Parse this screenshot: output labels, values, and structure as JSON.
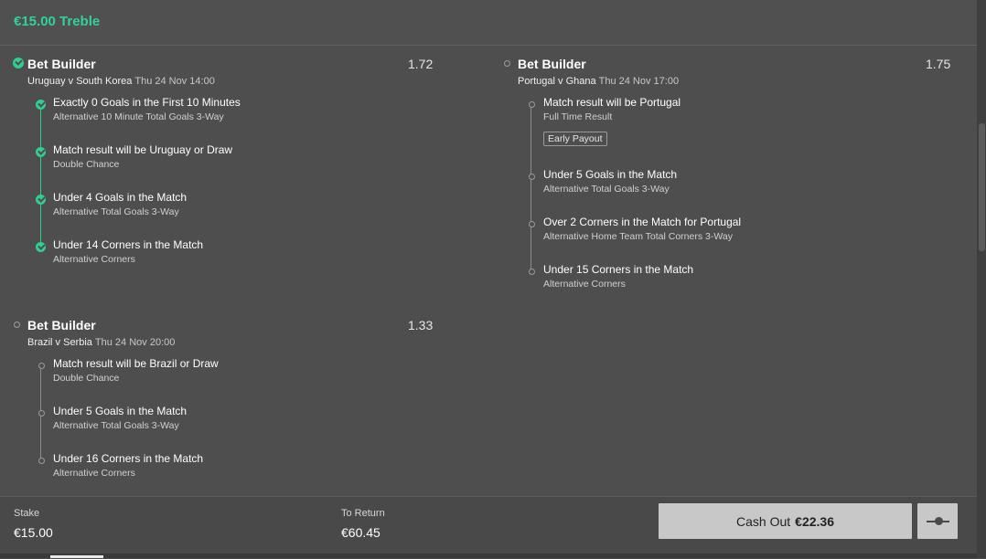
{
  "header": {
    "title": "€15.00 Treble"
  },
  "bet_builders": [
    {
      "title": "Bet Builder",
      "odds": "1.72",
      "match": "Uruguay v South Korea",
      "date": "Thu 24 Nov 14:00",
      "status": "settled",
      "legs": [
        {
          "name": "Exactly 0 Goals in the First 10 Minutes",
          "market": "Alternative 10 Minute Total Goals 3-Way"
        },
        {
          "name": "Match result will be Uruguay or Draw",
          "market": "Double Chance"
        },
        {
          "name": "Under 4 Goals in the Match",
          "market": "Alternative Total Goals 3-Way"
        },
        {
          "name": "Under 14 Corners in the Match",
          "market": "Alternative Corners"
        }
      ]
    },
    {
      "title": "Bet Builder",
      "odds": "1.75",
      "match": "Portugal v Ghana",
      "date": "Thu 24 Nov 17:00",
      "status": "open",
      "early_payout": "Early Payout",
      "legs": [
        {
          "name": "Match result will be Portugal",
          "market": "Full Time Result"
        },
        {
          "name": "Under 5 Goals in the Match",
          "market": "Alternative Total Goals 3-Way"
        },
        {
          "name": "Over 2 Corners in the Match for Portugal",
          "market": "Alternative Home Team Total Corners 3-Way"
        },
        {
          "name": "Under 15 Corners in the Match",
          "market": "Alternative Corners"
        }
      ]
    },
    {
      "title": "Bet Builder",
      "odds": "1.33",
      "match": "Brazil v Serbia",
      "date": "Thu 24 Nov 20:00",
      "status": "open",
      "legs": [
        {
          "name": "Match result will be Brazil or Draw",
          "market": "Double Chance"
        },
        {
          "name": "Under 5 Goals in the Match",
          "market": "Alternative Total Goals 3-Way"
        },
        {
          "name": "Under 16 Corners in the Match",
          "market": "Alternative Corners"
        }
      ]
    }
  ],
  "footer": {
    "stake_label": "Stake",
    "stake_value": "€15.00",
    "return_label": "To Return",
    "return_value": "€60.45",
    "cashout_label": "Cash Out",
    "cashout_value": "€22.36"
  },
  "colors": {
    "accent": "#31d29a",
    "background": "#4e4e4e",
    "button": "#c8c8c8"
  }
}
